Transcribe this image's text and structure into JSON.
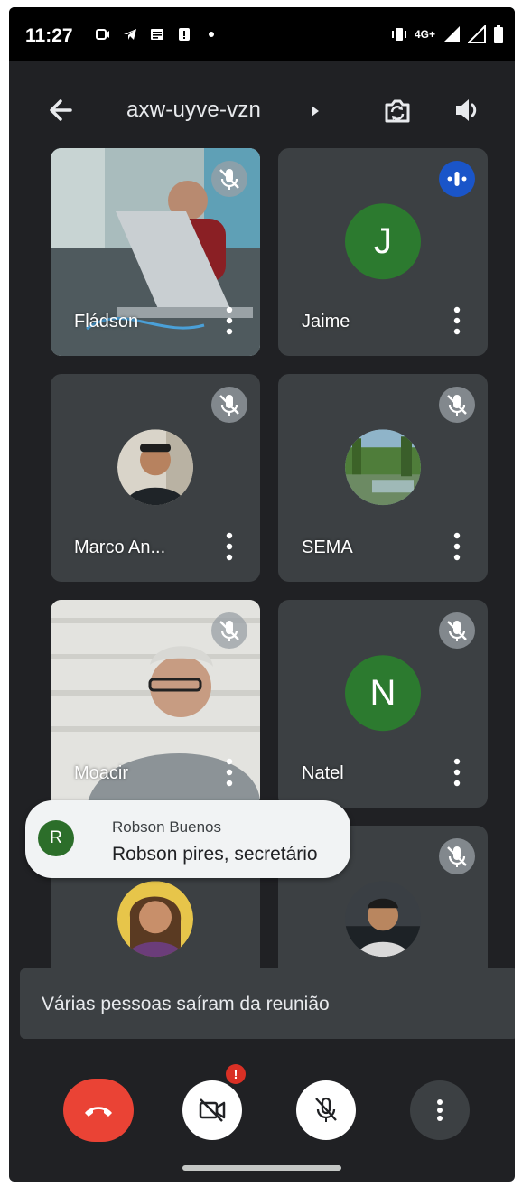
{
  "status_bar": {
    "time": "11:27",
    "network": "4G+"
  },
  "toolbar": {
    "meeting_code": "axw-uyve-vzn"
  },
  "participants": [
    {
      "name": "Fládson",
      "kind": "video",
      "mic": "muted"
    },
    {
      "name": "Jaime",
      "kind": "avatar",
      "initial": "J",
      "mic": "speaking"
    },
    {
      "name": "Marco An...",
      "kind": "photo",
      "mic": "muted"
    },
    {
      "name": "SEMA",
      "kind": "photo",
      "mic": "muted"
    },
    {
      "name": "Moacir",
      "kind": "video",
      "mic": "muted"
    },
    {
      "name": "Natel",
      "kind": "avatar",
      "initial": "N",
      "mic": "muted"
    },
    {
      "name": "",
      "kind": "photo",
      "mic": "none"
    },
    {
      "name": "",
      "kind": "photo",
      "mic": "muted"
    }
  ],
  "chat_toast": {
    "avatar_initial": "R",
    "sender": "Robson Buenos",
    "message": "Robson pires, secretário"
  },
  "snackbar": {
    "text": "Várias pessoas saíram da reunião"
  },
  "controls": {
    "camera_alert": "!"
  },
  "colors": {
    "background": "#202124",
    "tile": "#3c4043",
    "leave_red": "#ea4335",
    "avatar_green": "#2c7a2f",
    "speaking_blue": "#1a55c9"
  }
}
